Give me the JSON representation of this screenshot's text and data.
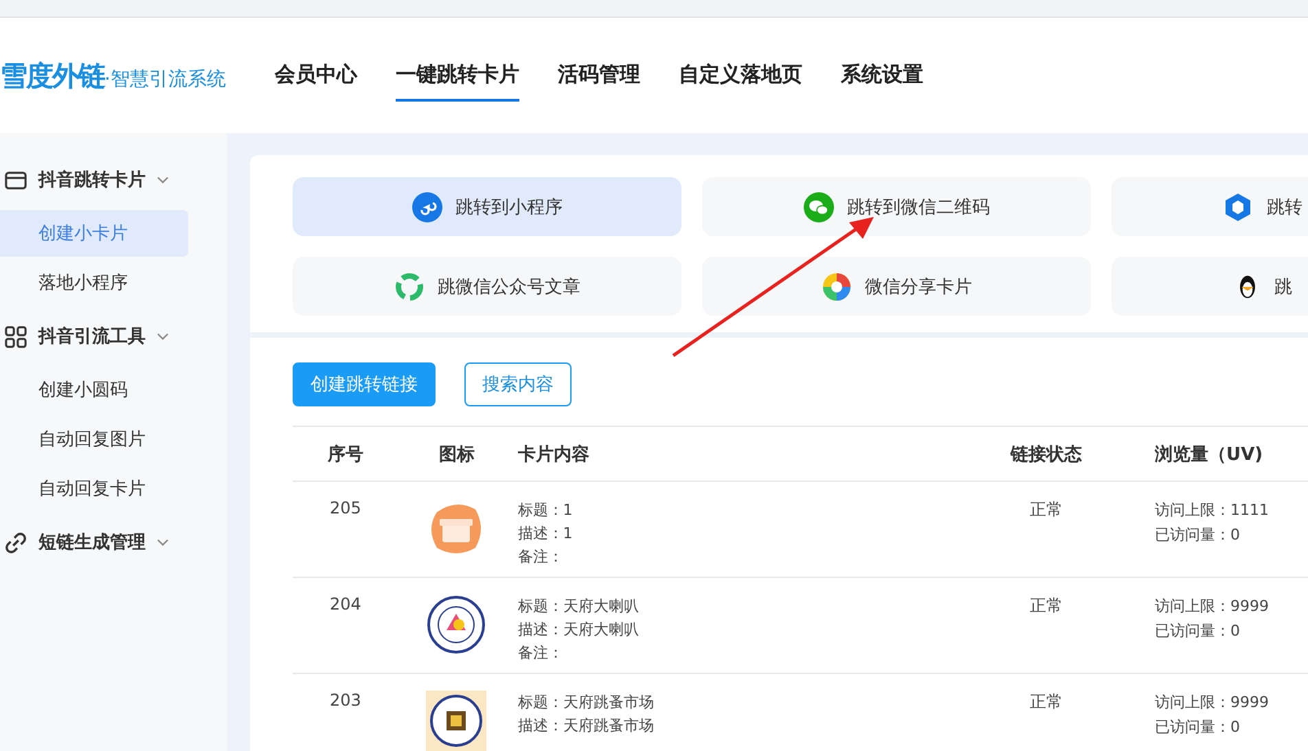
{
  "header": {
    "logo": "雪度外链",
    "logo_subtitle": "·智慧引流系统",
    "nav": [
      {
        "label": "会员中心",
        "selected": false
      },
      {
        "label": "一键跳转卡片",
        "selected": true
      },
      {
        "label": "活码管理",
        "selected": false
      },
      {
        "label": "自定义落地页",
        "selected": false
      },
      {
        "label": "系统设置",
        "selected": false
      }
    ]
  },
  "sidebar": {
    "groups": [
      {
        "label": "抖音跳转卡片",
        "kind": "card",
        "expanded": true,
        "items": [
          {
            "label": "创建小卡片",
            "selected": true
          },
          {
            "label": "落地小程序",
            "selected": false
          }
        ]
      },
      {
        "label": "抖音引流工具",
        "kind": "grid",
        "expanded": true,
        "items": [
          {
            "label": "创建小圆码",
            "selected": false
          },
          {
            "label": "自动回复图片",
            "selected": false
          },
          {
            "label": "自动回复卡片",
            "selected": false
          }
        ]
      },
      {
        "label": "短链生成管理",
        "kind": "link",
        "expanded": true
      }
    ]
  },
  "jump_types": [
    {
      "label": "跳转到小程序",
      "kind": "miniprogram",
      "selected": true
    },
    {
      "label": "跳转到微信二维码",
      "kind": "wechat",
      "selected": false
    },
    {
      "label": "跳转",
      "kind": "cube",
      "selected": false
    },
    {
      "label": "跳微信公众号文章",
      "kind": "official",
      "selected": false
    },
    {
      "label": "微信分享卡片",
      "kind": "aperture",
      "selected": false
    },
    {
      "label": "跳",
      "kind": "penguin",
      "selected": false
    }
  ],
  "actions": {
    "create": "创建跳转链接",
    "search": "搜索内容"
  },
  "table": {
    "columns": [
      "序号",
      "图标",
      "卡片内容",
      "链接状态",
      "浏览量（UV)"
    ],
    "rows": [
      {
        "id": "205",
        "kind": "gift",
        "lines": [
          "标题：1",
          "描述：1",
          "备注："
        ],
        "status": "正常",
        "stats": [
          "访问上限：1111",
          "已访问量：0"
        ]
      },
      {
        "id": "204",
        "kind": "badge",
        "lines": [
          "标题：天府大喇叭",
          "描述：天府大喇叭",
          "备注："
        ],
        "status": "正常",
        "stats": [
          "访问上限：9999",
          "已访问量：0"
        ]
      },
      {
        "id": "203",
        "kind": "square-badge",
        "lines": [
          "标题：天府跳蚤市场",
          "描述：天府跳蚤市场"
        ],
        "status": "正常",
        "stats": [
          "访问上限：9999",
          "已访问量：0"
        ]
      }
    ]
  }
}
